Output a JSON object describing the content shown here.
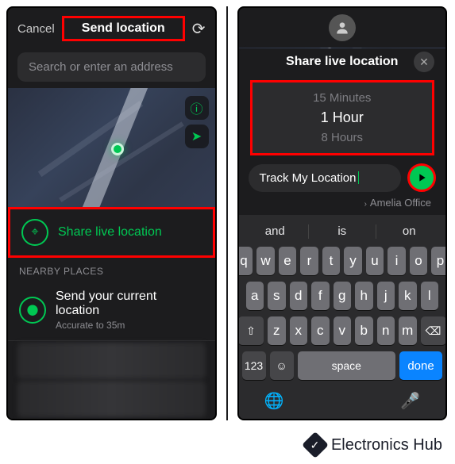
{
  "left": {
    "cancel": "Cancel",
    "title": "Send location",
    "search_placeholder": "Search or enter an address",
    "share_live": "Share live location",
    "nearby_header": "NEARBY PLACES",
    "current_loc_title": "Send your current location",
    "current_loc_sub": "Accurate to 35m"
  },
  "right": {
    "sheet_title": "Share live location",
    "options": {
      "a": "15 Minutes",
      "b": "1 Hour",
      "c": "8 Hours"
    },
    "caption": "Track My Location",
    "recipient": "Amelia Office"
  },
  "kbd": {
    "sugg": {
      "a": "and",
      "b": "is",
      "c": "on"
    },
    "r1": {
      "q": "q",
      "w": "w",
      "e": "e",
      "r": "r",
      "t": "t",
      "y": "y",
      "u": "u",
      "i": "i",
      "o": "o",
      "p": "p"
    },
    "r2": {
      "a": "a",
      "s": "s",
      "d": "d",
      "f": "f",
      "g": "g",
      "h": "h",
      "j": "j",
      "k": "k",
      "l": "l"
    },
    "r3": {
      "z": "z",
      "x": "x",
      "c": "c",
      "v": "v",
      "b": "b",
      "n": "n",
      "m": "m"
    },
    "num": "123",
    "space": "space",
    "done": "done"
  },
  "credit": "Electronics Hub"
}
